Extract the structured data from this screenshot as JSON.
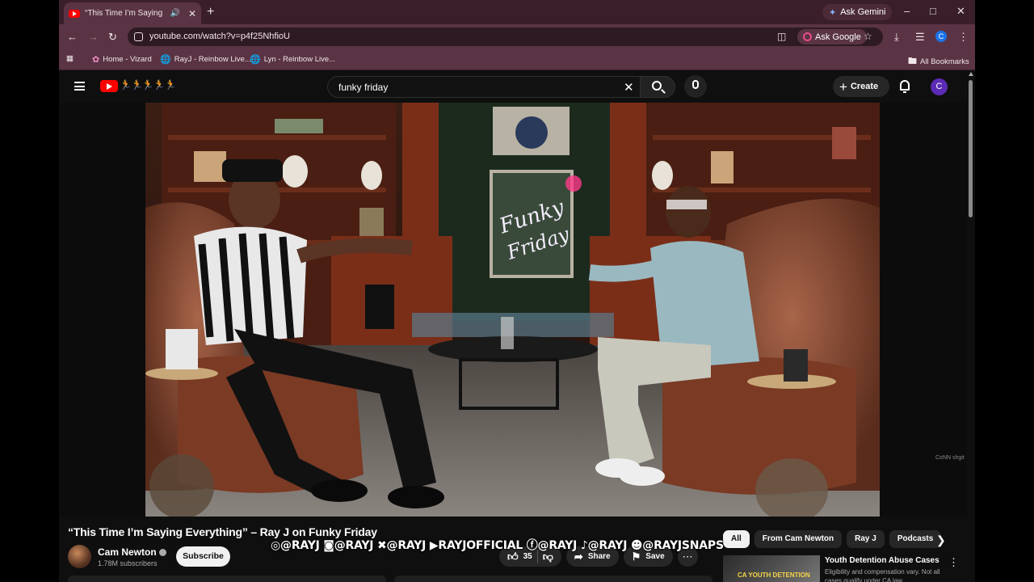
{
  "browser": {
    "tab_title": "“This Time I’m Saying Every",
    "tab_audio_icon": "speaker-icon",
    "ask_gemini": "Ask Gemini",
    "url": "youtube.com/watch?v=p4f25NhfioU",
    "ask_google": "Ask Google",
    "profile_initial": "C",
    "bookmarks": [
      "Home - Vizard",
      "RayJ - Reinbow Live...",
      "Lyn - Reinbow Live..."
    ],
    "all_bookmarks": "All Bookmarks"
  },
  "youtube": {
    "search_query": "funky friday",
    "create_label": "Create",
    "avatar_initial": "C"
  },
  "video": {
    "title": "“This Time I’m Saying Everything” – Ray J on Funky Friday",
    "channel_name": "Cam Newton",
    "subscribers": "1.78M subscribers",
    "subscribe_label": "Subscribe",
    "likes": "35",
    "share_label": "Share",
    "save_label": "Save",
    "overlay_socials": "◎@RAYJ ◙@RAYJ ✖@RAYJ ▶RAYJOFFICIAL ⓕ@RAYJ ♪@RAYJ ☻@RAYJSNAPS",
    "corner_mark": "CoNN shgit"
  },
  "sidebar": {
    "chips": [
      "All",
      "From Cam Newton",
      "Ray J",
      "Podcasts"
    ],
    "ad_title": "Youth Detention Abuse Cases",
    "ad_desc": "Eligibility and compensation vary. Not all cases qualify under CA law.",
    "ad_thumb_text": "CA YOUTH DETENTION"
  },
  "colors": {
    "browser_frame": "#5a3444",
    "youtube_bg": "#0f0f0f",
    "youtube_red": "#ff0000"
  }
}
